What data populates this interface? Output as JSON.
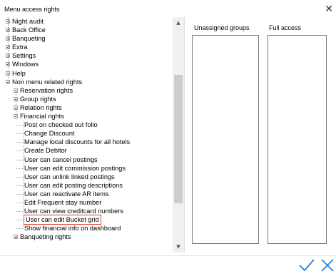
{
  "window": {
    "title": "Menu access rights"
  },
  "tree": {
    "items": [
      {
        "label": "Night audit",
        "level": 0,
        "toggle": "plus"
      },
      {
        "label": "Back Office",
        "level": 0,
        "toggle": "plus"
      },
      {
        "label": "Banqueting",
        "level": 0,
        "toggle": "plus"
      },
      {
        "label": "Extra",
        "level": 0,
        "toggle": "plus"
      },
      {
        "label": "Settings",
        "level": 0,
        "toggle": "plus"
      },
      {
        "label": "Windows",
        "level": 0,
        "toggle": "plus"
      },
      {
        "label": "Help",
        "level": 0,
        "toggle": "plus"
      },
      {
        "label": "Non menu related rights",
        "level": 0,
        "toggle": "minus"
      },
      {
        "label": "Reservation rights",
        "level": 1,
        "toggle": "plus"
      },
      {
        "label": "Group rights",
        "level": 1,
        "toggle": "plus"
      },
      {
        "label": "Relation rights",
        "level": 1,
        "toggle": "plus"
      },
      {
        "label": "Financial rights",
        "level": 1,
        "toggle": "minus"
      },
      {
        "label": "Post on checked out folio",
        "level": 2,
        "toggle": "none"
      },
      {
        "label": "Change Discount",
        "level": 2,
        "toggle": "none"
      },
      {
        "label": "Manage local discounts for all hotels",
        "level": 2,
        "toggle": "none"
      },
      {
        "label": "Create Debitor",
        "level": 2,
        "toggle": "none"
      },
      {
        "label": "User can cancel postings",
        "level": 2,
        "toggle": "none"
      },
      {
        "label": "User can edit commission postings",
        "level": 2,
        "toggle": "none"
      },
      {
        "label": "User can unlink linked postings",
        "level": 2,
        "toggle": "none"
      },
      {
        "label": "User can edit posting descriptions",
        "level": 2,
        "toggle": "none"
      },
      {
        "label": "User can reactivate AR items",
        "level": 2,
        "toggle": "none"
      },
      {
        "label": "Edit Frequent stay number",
        "level": 2,
        "toggle": "none"
      },
      {
        "label": "User can view creditcard numbers",
        "level": 2,
        "toggle": "none"
      },
      {
        "label": "User can edit Bucket grid",
        "level": 2,
        "toggle": "none",
        "highlighted": true
      },
      {
        "label": "Show financial info on dashboard",
        "level": 2,
        "toggle": "none"
      },
      {
        "label": "Banqueting rights",
        "level": 1,
        "toggle": "plus"
      }
    ],
    "scroll_position": 0.55
  },
  "panels": {
    "unassigned_groups": {
      "header": "Unassigned groups"
    },
    "full_access": {
      "header": "Full access"
    }
  },
  "icons": {
    "close": "close-x-icon",
    "ok": "checkmark-icon",
    "cancel": "cross-icon",
    "scroll_up": "chevron-up-icon",
    "scroll_down": "chevron-down-icon"
  },
  "colors": {
    "highlight_border": "#e0352b",
    "ok_icon": "#2f7fd4",
    "cancel_icon": "#2f7fd4"
  }
}
